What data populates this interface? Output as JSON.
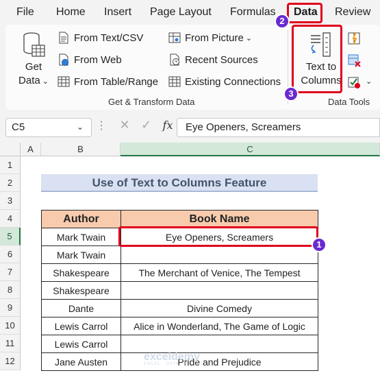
{
  "menu": {
    "items": [
      "File",
      "Home",
      "Insert",
      "Page Layout",
      "Formulas",
      "Data",
      "Review"
    ],
    "active": "Data"
  },
  "ribbon": {
    "get_data_label_1": "Get",
    "get_data_label_2": "Data",
    "from_text_csv": "From Text/CSV",
    "from_web": "From Web",
    "from_table_range": "From Table/Range",
    "from_picture": "From Picture",
    "recent_sources": "Recent Sources",
    "existing_connections": "Existing Connections",
    "text_to_columns_1": "Text to",
    "text_to_columns_2": "Columns",
    "group_get_transform": "Get & Transform Data",
    "group_data_tools": "Data Tools",
    "icons": [
      "database-icon",
      "text-file-icon",
      "globe-icon",
      "table-icon",
      "picture-icon",
      "recent-sources-icon",
      "connections-icon",
      "text-to-columns-icon",
      "flash-fill-icon",
      "remove-duplicates-icon",
      "data-validation-icon"
    ]
  },
  "formula_bar": {
    "name_box": "C5",
    "fx": "fx",
    "content": "Eye Openers, Screamers"
  },
  "grid": {
    "columns": [
      "A",
      "B",
      "C"
    ],
    "selected_column": "C",
    "rows": [
      "1",
      "2",
      "3",
      "4",
      "5",
      "6",
      "7",
      "8",
      "9",
      "10",
      "11",
      "12"
    ],
    "selected_row": "5"
  },
  "sheet": {
    "title": "Use of Text to Columns Feature",
    "headers": [
      "Author",
      "Book Name"
    ],
    "rows": [
      [
        "Mark Twain",
        "Eye Openers, Screamers"
      ],
      [
        "Mark Twain",
        ""
      ],
      [
        "Shakespeare",
        "The Merchant of Venice, The Tempest"
      ],
      [
        "Shakespeare",
        ""
      ],
      [
        "Dante",
        "Divine Comedy"
      ],
      [
        "Lewis Carrol",
        "Alice in Wonderland, The Game of Logic"
      ],
      [
        "Lewis Carrol",
        ""
      ],
      [
        "Jane Austen",
        "Pride and Prejudice"
      ]
    ]
  },
  "callouts": {
    "badge_1": "1",
    "badge_2": "2",
    "badge_3": "3",
    "color": "#e0001b",
    "badge_color": "#6a2ad1"
  },
  "watermark": {
    "name": "exceldemy",
    "tagline": "EXCEL · DATA · BI"
  }
}
